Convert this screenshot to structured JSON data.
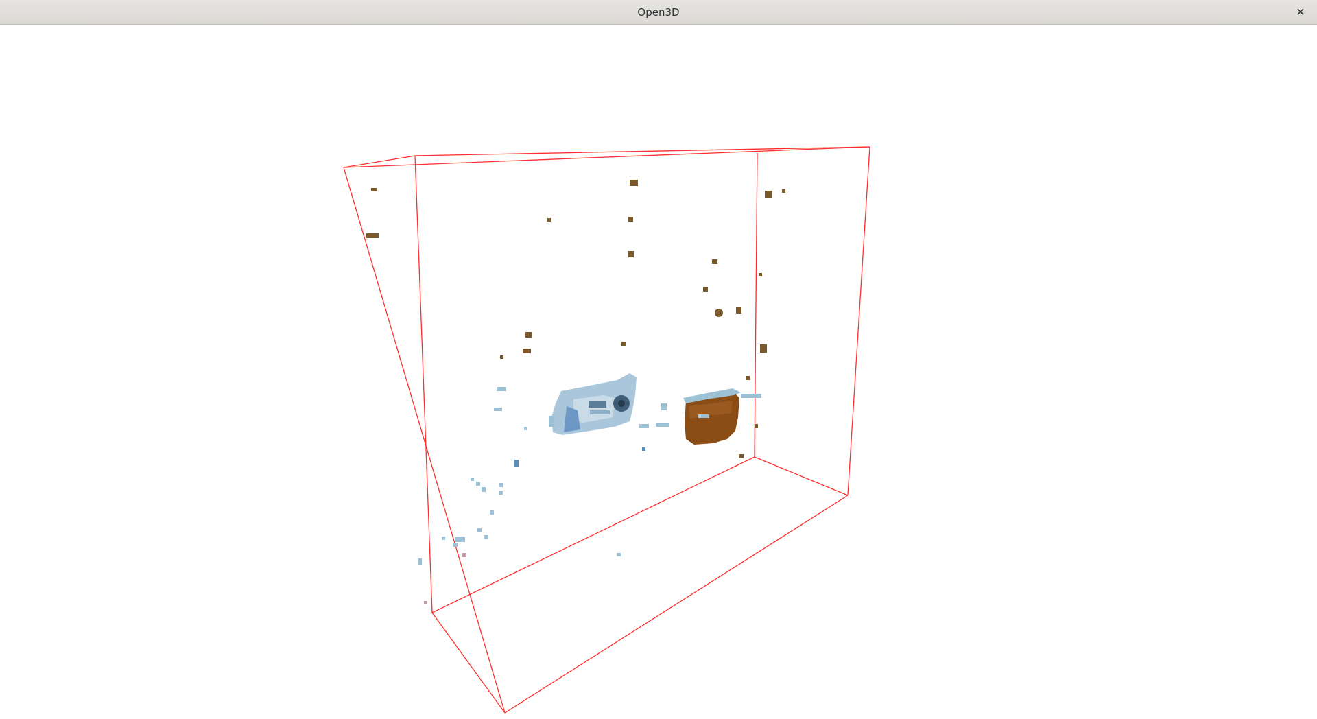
{
  "window": {
    "title": "Open3D",
    "close_glyph": "✕"
  },
  "colors": {
    "bounding_box": "#ff2d2d",
    "background": "#ffffff",
    "object_blue": "#a9c4d8",
    "object_brown": "#8a4d16",
    "noise_brown": "#7a5a2c",
    "noise_blue": "#9cc0d4"
  }
}
